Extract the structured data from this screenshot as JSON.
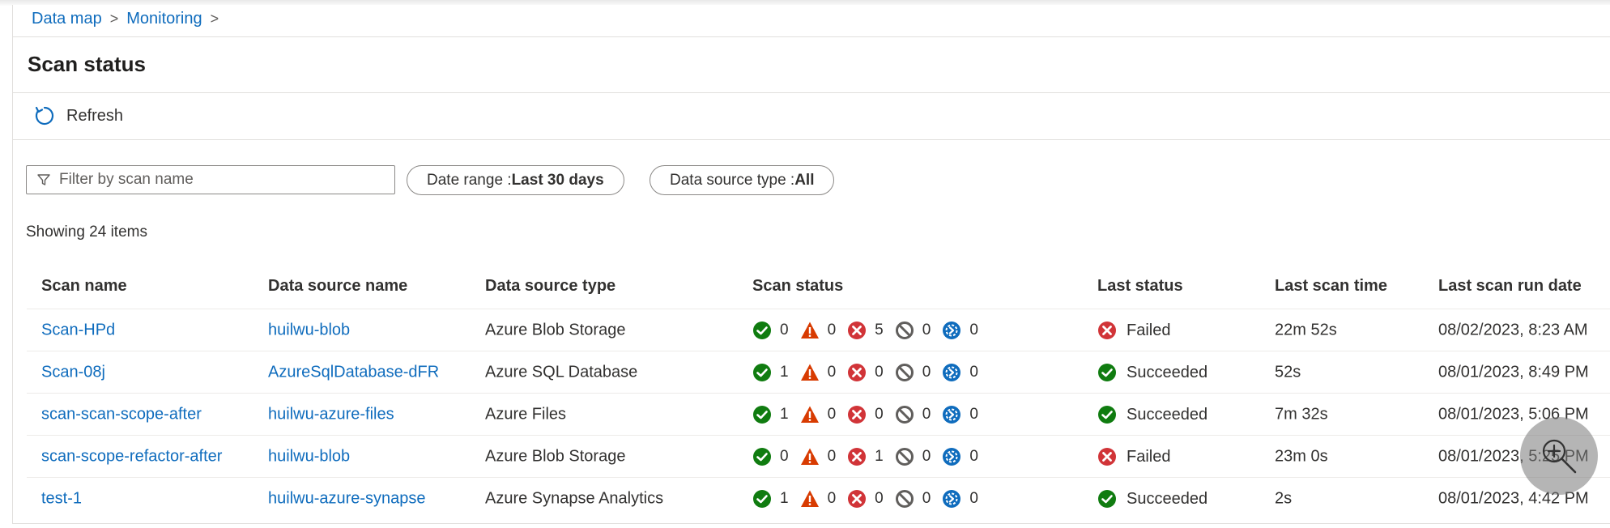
{
  "breadcrumb": {
    "items": [
      "Data map",
      "Monitoring"
    ],
    "separator": ">"
  },
  "page": {
    "title": "Scan status"
  },
  "toolbar": {
    "refresh_label": "Refresh"
  },
  "filters": {
    "search_placeholder": "Filter by scan name",
    "date_range_label": "Date range : ",
    "date_range_value": "Last 30 days",
    "source_type_label": "Data source type : ",
    "source_type_value": "All"
  },
  "summary": {
    "count_text": "Showing 24 items"
  },
  "table": {
    "columns": [
      "Scan name",
      "Data source name",
      "Data source type",
      "Scan status",
      "Last status",
      "Last scan time",
      "Last scan run date"
    ],
    "rows": [
      {
        "scan_name": "Scan-HPd",
        "source_name": "huilwu-blob",
        "source_type": "Azure Blob Storage",
        "counts": {
          "succeeded": "0",
          "warning": "0",
          "failed": "5",
          "canceled": "0",
          "in_progress": "0"
        },
        "last_status": "Failed",
        "last_status_kind": "failed",
        "last_scan_time": "22m 52s",
        "last_run_date": "08/02/2023, 8:23 AM"
      },
      {
        "scan_name": "Scan-08j",
        "source_name": "AzureSqlDatabase-dFR",
        "source_type": "Azure SQL Database",
        "counts": {
          "succeeded": "1",
          "warning": "0",
          "failed": "0",
          "canceled": "0",
          "in_progress": "0"
        },
        "last_status": "Succeeded",
        "last_status_kind": "succeeded",
        "last_scan_time": "52s",
        "last_run_date": "08/01/2023, 8:49 PM"
      },
      {
        "scan_name": "scan-scan-scope-after",
        "source_name": "huilwu-azure-files",
        "source_type": "Azure Files",
        "counts": {
          "succeeded": "1",
          "warning": "0",
          "failed": "0",
          "canceled": "0",
          "in_progress": "0"
        },
        "last_status": "Succeeded",
        "last_status_kind": "succeeded",
        "last_scan_time": "7m 32s",
        "last_run_date": "08/01/2023, 5:06 PM"
      },
      {
        "scan_name": "scan-scope-refactor-after",
        "source_name": "huilwu-blob",
        "source_type": "Azure Blob Storage",
        "counts": {
          "succeeded": "0",
          "warning": "0",
          "failed": "1",
          "canceled": "0",
          "in_progress": "0"
        },
        "last_status": "Failed",
        "last_status_kind": "failed",
        "last_scan_time": "23m 0s",
        "last_run_date": "08/01/2023, 5:25 PM"
      },
      {
        "scan_name": "test-1",
        "source_name": "huilwu-azure-synapse",
        "source_type": "Azure Synapse Analytics",
        "counts": {
          "succeeded": "1",
          "warning": "0",
          "failed": "0",
          "canceled": "0",
          "in_progress": "0"
        },
        "last_status": "Succeeded",
        "last_status_kind": "succeeded",
        "last_scan_time": "2s",
        "last_run_date": "08/01/2023, 4:42 PM"
      }
    ]
  },
  "colors": {
    "link": "#0f6cbd",
    "succeeded": "#107c10",
    "warning": "#d83b01",
    "failed": "#d13438",
    "canceled": "#605e5c",
    "in_progress": "#0f6cbd"
  },
  "icons": {
    "succeeded": "check-circle-icon",
    "warning": "warning-triangle-icon",
    "failed": "error-circle-icon",
    "canceled": "blocked-circle-icon",
    "in_progress": "in-progress-circle-icon",
    "zoom": "zoom-in-icon"
  }
}
